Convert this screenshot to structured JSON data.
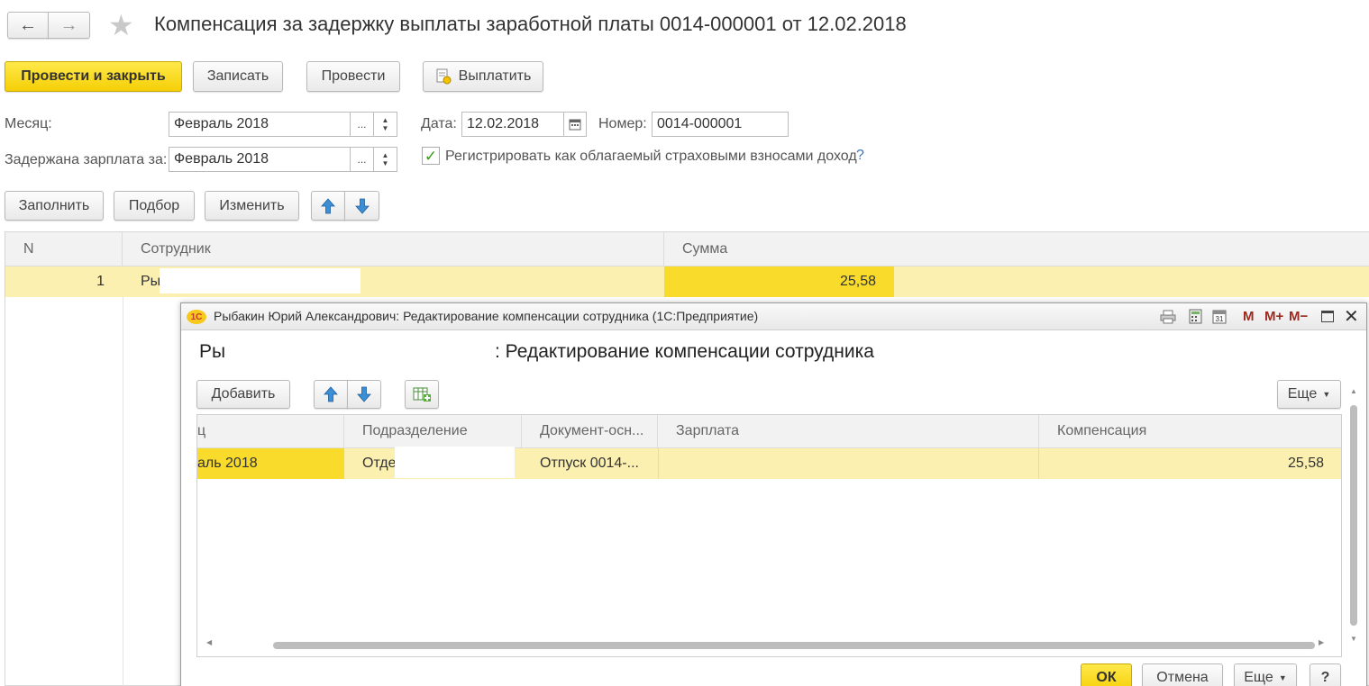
{
  "window": {
    "title": "Компенсация за задержку выплаты заработной платы 0014-000001 от 12.02.2018"
  },
  "toolbar": {
    "post_close": "Провести и закрыть",
    "save": "Записать",
    "post": "Провести",
    "pay": "Выплатить"
  },
  "form": {
    "month_label": "Месяц:",
    "month_value": "Февраль 2018",
    "delayed_label": "Задержана зарплата за:",
    "delayed_value": "Февраль 2018",
    "date_label": "Дата:",
    "date_value": "12.02.2018",
    "number_label": "Номер:",
    "number_value": "0014-000001",
    "register_checkbox_label": "Регистрировать как облагаемый страховыми взносами доход",
    "register_checked": true,
    "help": "?",
    "ellipsis": "..."
  },
  "table_toolbar": {
    "fill": "Заполнить",
    "pick": "Подбор",
    "change": "Изменить"
  },
  "table": {
    "headers": [
      "N",
      "Сотрудник",
      "Сумма"
    ],
    "rows": [
      {
        "n": "1",
        "employee": "Ры",
        "sum": "25,58"
      }
    ]
  },
  "popup": {
    "title": "Рыбакин Юрий Александрович: Редактирование компенсации сотрудника  (1С:Предприятие)",
    "header_prefix": "Ры",
    "header_suffix": ": Редактирование компенсации сотрудника",
    "toolbar": {
      "add": "Добавить",
      "more": "Еще"
    },
    "window_buttons": {
      "m": "M",
      "m_plus": "M+",
      "m_minus": "M−"
    },
    "headers": [
      "ц",
      "Подразделение",
      "Документ-осн...",
      "Зарплата",
      "Компенсация"
    ],
    "rows": [
      {
        "month": "аль 2018",
        "department": "Отде",
        "document": "Отпуск 0014-...",
        "salary": "",
        "compensation": "25,58"
      }
    ],
    "footer": {
      "ok": "ОК",
      "cancel": "Отмена",
      "more": "Еще",
      "help": "?"
    }
  },
  "colors": {
    "accent_yellow": "#f5cf06",
    "row_highlight": "#fbf0b0",
    "cell_active": "#f9dc2b",
    "help_blue": "#3a76b8",
    "arrow_blue": "#3c8fd6"
  }
}
